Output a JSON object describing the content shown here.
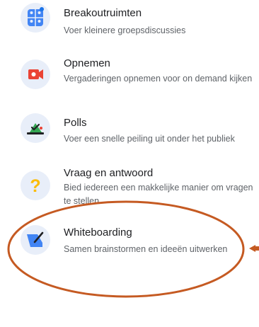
{
  "menu": {
    "items": [
      {
        "title": "Breakoutruimten",
        "description": "Voer kleinere groepsdiscussies",
        "icon": "breakout-rooms-icon"
      },
      {
        "title": "Opnemen",
        "description": "Vergaderingen opnemen voor on demand kijken",
        "icon": "record-icon"
      },
      {
        "title": "Polls",
        "description": "Voer een snelle peiling uit onder het publiek",
        "icon": "poll-icon"
      },
      {
        "title": "Vraag en antwoord",
        "description": "Bied iedereen een makkelijke manier om vragen te stellen",
        "icon": "question-icon"
      },
      {
        "title": "Whiteboarding",
        "description": "Samen brainstormen en ideeën uitwerken",
        "icon": "whiteboard-icon"
      }
    ]
  },
  "colors": {
    "icon_background": "#e8eef9",
    "annotation": "#c55a22",
    "blue": "#4285f4",
    "red": "#ea4335",
    "green": "#34a853",
    "yellow": "#fbbc04"
  }
}
